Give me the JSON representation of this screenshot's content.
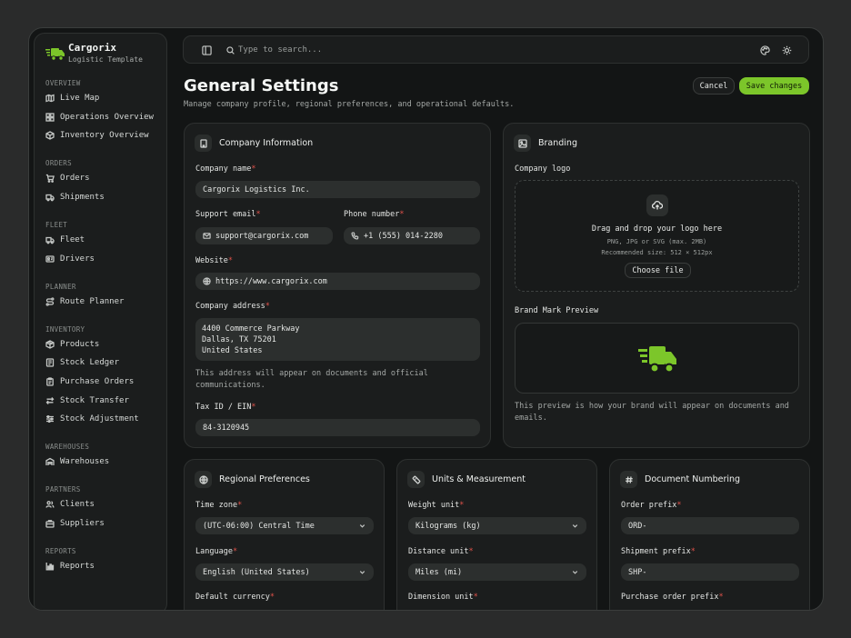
{
  "brand": {
    "name": "Cargorix",
    "subtitle": "Logistic Template",
    "accent": "#7cc62a"
  },
  "sidebar": {
    "sections": [
      {
        "title": "OVERVIEW",
        "items": [
          {
            "label": "Live Map",
            "icon": "map-icon"
          },
          {
            "label": "Operations Overview",
            "icon": "grid-icon"
          },
          {
            "label": "Inventory Overview",
            "icon": "box-icon"
          }
        ]
      },
      {
        "title": "ORDERS",
        "items": [
          {
            "label": "Orders",
            "icon": "cart-icon"
          },
          {
            "label": "Shipments",
            "icon": "truck-icon"
          }
        ]
      },
      {
        "title": "FLEET",
        "items": [
          {
            "label": "Fleet",
            "icon": "truck-icon"
          },
          {
            "label": "Drivers",
            "icon": "id-card-icon"
          }
        ]
      },
      {
        "title": "PLANNER",
        "items": [
          {
            "label": "Route Planner",
            "icon": "route-icon"
          }
        ]
      },
      {
        "title": "INVENTORY",
        "items": [
          {
            "label": "Products",
            "icon": "package-icon"
          },
          {
            "label": "Stock Ledger",
            "icon": "ledger-icon"
          },
          {
            "label": "Purchase Orders",
            "icon": "clipboard-icon"
          },
          {
            "label": "Stock Transfer",
            "icon": "swap-icon"
          },
          {
            "label": "Stock Adjustment",
            "icon": "sliders-icon"
          }
        ]
      },
      {
        "title": "WAREHOUSES",
        "items": [
          {
            "label": "Warehouses",
            "icon": "warehouse-icon"
          }
        ]
      },
      {
        "title": "PARTNERS",
        "items": [
          {
            "label": "Clients",
            "icon": "users-icon"
          },
          {
            "label": "Suppliers",
            "icon": "supplier-icon"
          }
        ]
      },
      {
        "title": "REPORTS",
        "items": [
          {
            "label": "Reports",
            "icon": "chart-icon"
          }
        ]
      }
    ]
  },
  "topbar": {
    "search_placeholder": "Type to search..."
  },
  "header": {
    "title": "General Settings",
    "subtitle": "Manage company profile, regional preferences, and operational defaults.",
    "cancel_label": "Cancel",
    "save_label": "Save changes"
  },
  "company": {
    "title": "Company Information",
    "name_label": "Company name",
    "name_value": "Cargorix Logistics Inc.",
    "email_label": "Support email",
    "email_value": "support@cargorix.com",
    "phone_label": "Phone number",
    "phone_value": "+1 (555) 014-2280",
    "website_label": "Website",
    "website_value": "https://www.cargorix.com",
    "address_label": "Company address",
    "address_lines": [
      "4400 Commerce Parkway",
      "Dallas, TX 75201",
      "United States"
    ],
    "address_hint": "This address will appear on documents and official communications.",
    "tax_label": "Tax ID / EIN",
    "tax_value": "84-3120945"
  },
  "branding": {
    "title": "Branding",
    "logo_label": "Company logo",
    "drop_title": "Drag and drop your logo here",
    "drop_formats": "PNG, JPG or SVG (max. 2MB)",
    "drop_size": "Recommended size: 512 × 512px",
    "choose_label": "Choose file",
    "preview_label": "Brand Mark Preview",
    "preview_hint": "This preview is how your brand will appear on documents and emails."
  },
  "regional": {
    "title": "Regional Preferences",
    "timezone_label": "Time zone",
    "timezone_value": "(UTC-06:00) Central Time",
    "language_label": "Language",
    "language_value": "English (United States)",
    "currency_label": "Default currency"
  },
  "units": {
    "title": "Units & Measurement",
    "weight_label": "Weight unit",
    "weight_value": "Kilograms (kg)",
    "distance_label": "Distance unit",
    "distance_value": "Miles (mi)",
    "dimension_label": "Dimension unit"
  },
  "numbering": {
    "title": "Document Numbering",
    "order_label": "Order prefix",
    "order_value": "ORD-",
    "shipment_label": "Shipment prefix",
    "shipment_value": "SHP-",
    "po_label": "Purchase order prefix"
  }
}
